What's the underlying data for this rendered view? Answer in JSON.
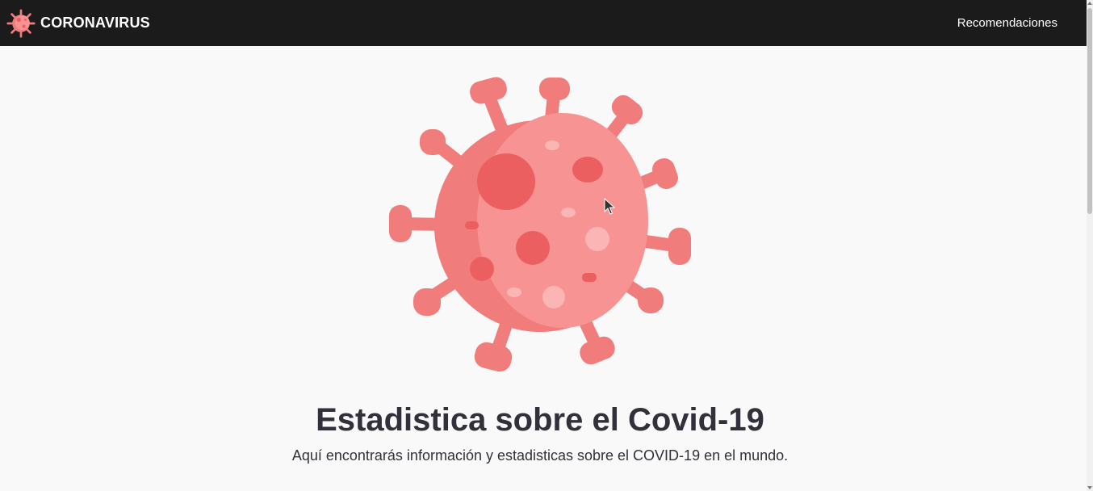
{
  "navbar": {
    "brand_icon": "virus-icon",
    "brand_text": "CORONAVIRUS",
    "link_recommendations": "Recomendaciones"
  },
  "hero": {
    "illustration_icon": "coronavirus-illustration",
    "title": "Estadistica sobre el Covid-19",
    "subtitle": "Aquí encontrarás información y estadisticas sobre el COVID-19 en el mundo."
  },
  "colors": {
    "navbar_bg": "#1b1b1c",
    "page_bg": "#f9f9f9",
    "virus_dark": "#f07c7c",
    "virus_light": "#f89393",
    "virus_spot": "#ec5f60",
    "text": "#32303a"
  }
}
